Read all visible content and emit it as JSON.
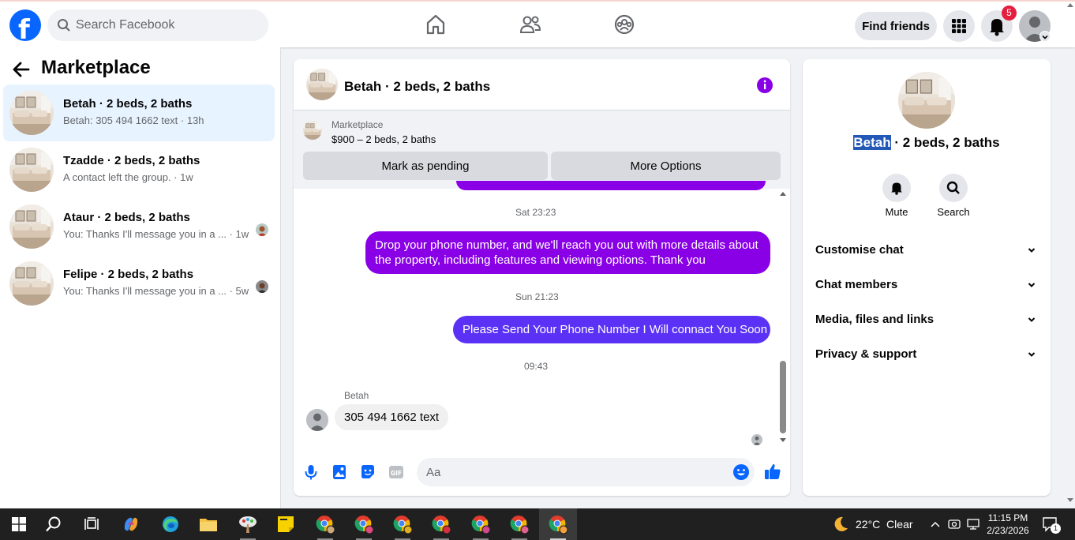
{
  "topbar": {
    "logo_letter": "f",
    "search_placeholder": "Search Facebook",
    "find_friends": "Find friends",
    "notification_count": "5"
  },
  "left": {
    "title": "Marketplace",
    "conversations": [
      {
        "title": "Betah · 2 beds, 2 baths",
        "subtitle": "Betah: 305 494 1662 text · 13h",
        "active": true
      },
      {
        "title": "Tzadde · 2 beds, 2 baths",
        "subtitle": "A contact left the group. · 1w"
      },
      {
        "title": "Ataur · 2 beds, 2 baths",
        "subtitle": "You: Thanks I'll message you in a ... · 1w"
      },
      {
        "title": "Felipe · 2 beds, 2 baths",
        "subtitle": "You: Thanks I'll message you in a ... · 5w"
      }
    ]
  },
  "chat": {
    "title": "Betah · 2 beds, 2 baths",
    "listing": {
      "label": "Marketplace",
      "price_line": "$900 – 2 beds, 2 baths",
      "pending_button": "Mark as pending",
      "options_button": "More Options"
    },
    "messages": {
      "ts1": "Sat 23:23",
      "msg1": "Drop your phone number, and we'll reach you out with more details about the property, including features and viewing options.  Thank you",
      "ts2": "Sun 21:23",
      "msg2": "Please Send Your Phone Number I Will connact You Soon",
      "ts3": "09:43",
      "sender": "Betah",
      "msg3": "305 494 1662 text"
    },
    "composer_placeholder": "Aa"
  },
  "right": {
    "name_highlight": "Betah",
    "name_rest": " · 2 beds, 2 baths",
    "actions": {
      "mute": "Mute",
      "search": "Search"
    },
    "sections": [
      "Customise chat",
      "Chat members",
      "Media, files and links",
      "Privacy & support"
    ]
  },
  "taskbar": {
    "weather": "22°C  Clear",
    "time": "11:15 PM",
    "date": "2/23/2026",
    "notif_count": "1"
  },
  "colors": {
    "brand_blue": "#0866ff",
    "outgoing_purple": "#8a00e6",
    "outgoing_indigo": "#5b32f5",
    "highlight": "#2458b6"
  }
}
